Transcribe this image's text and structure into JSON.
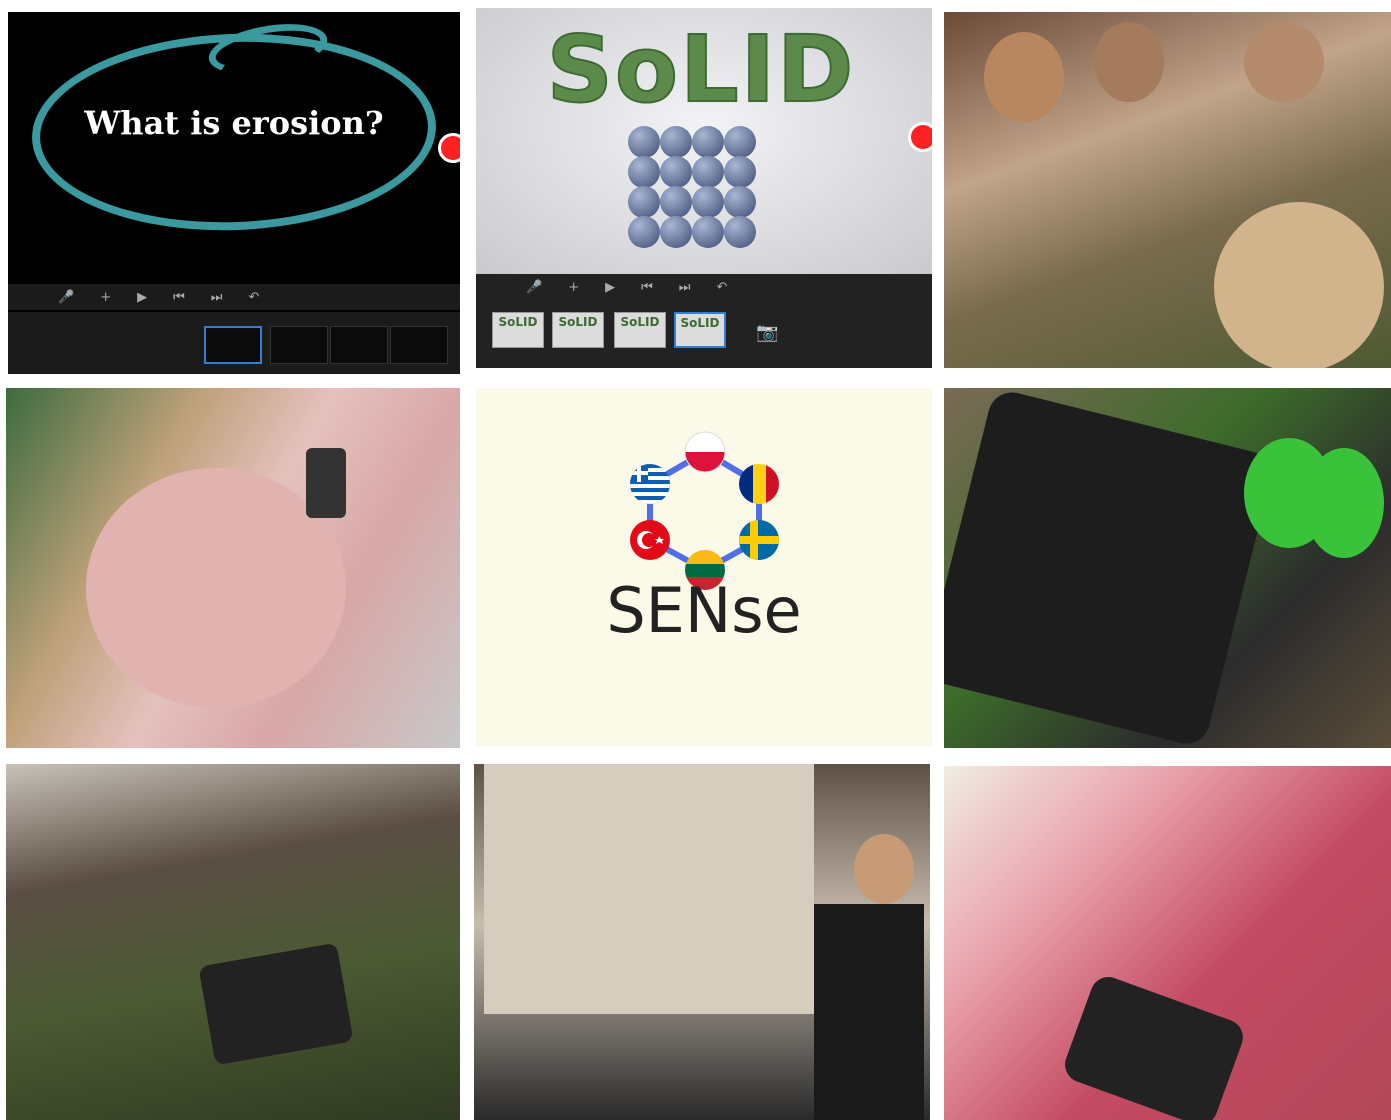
{
  "erosion_app": {
    "title": "What is erosion?",
    "accent": "#3a9aa0",
    "record_color": "#ff2222",
    "toolbar_icons": [
      "mic-icon",
      "plus-icon",
      "play-icon",
      "skip-back-icon",
      "skip-forward-icon",
      "undo-icon"
    ]
  },
  "solid_app": {
    "word": "SoLID",
    "thumb_label": "SoLID",
    "toolbar_icons": [
      "mic-icon",
      "plus-icon",
      "play-icon",
      "skip-back-icon",
      "skip-forward-icon",
      "undo-icon",
      "camera-icon"
    ]
  },
  "logo": {
    "brand": "SENse",
    "flags": [
      "poland-flag-icon",
      "romania-flag-icon",
      "sweden-flag-icon",
      "lithuania-flag-icon",
      "turkey-flag-icon",
      "greece-flag-icon"
    ],
    "ring_color": "#4f6ee8"
  }
}
